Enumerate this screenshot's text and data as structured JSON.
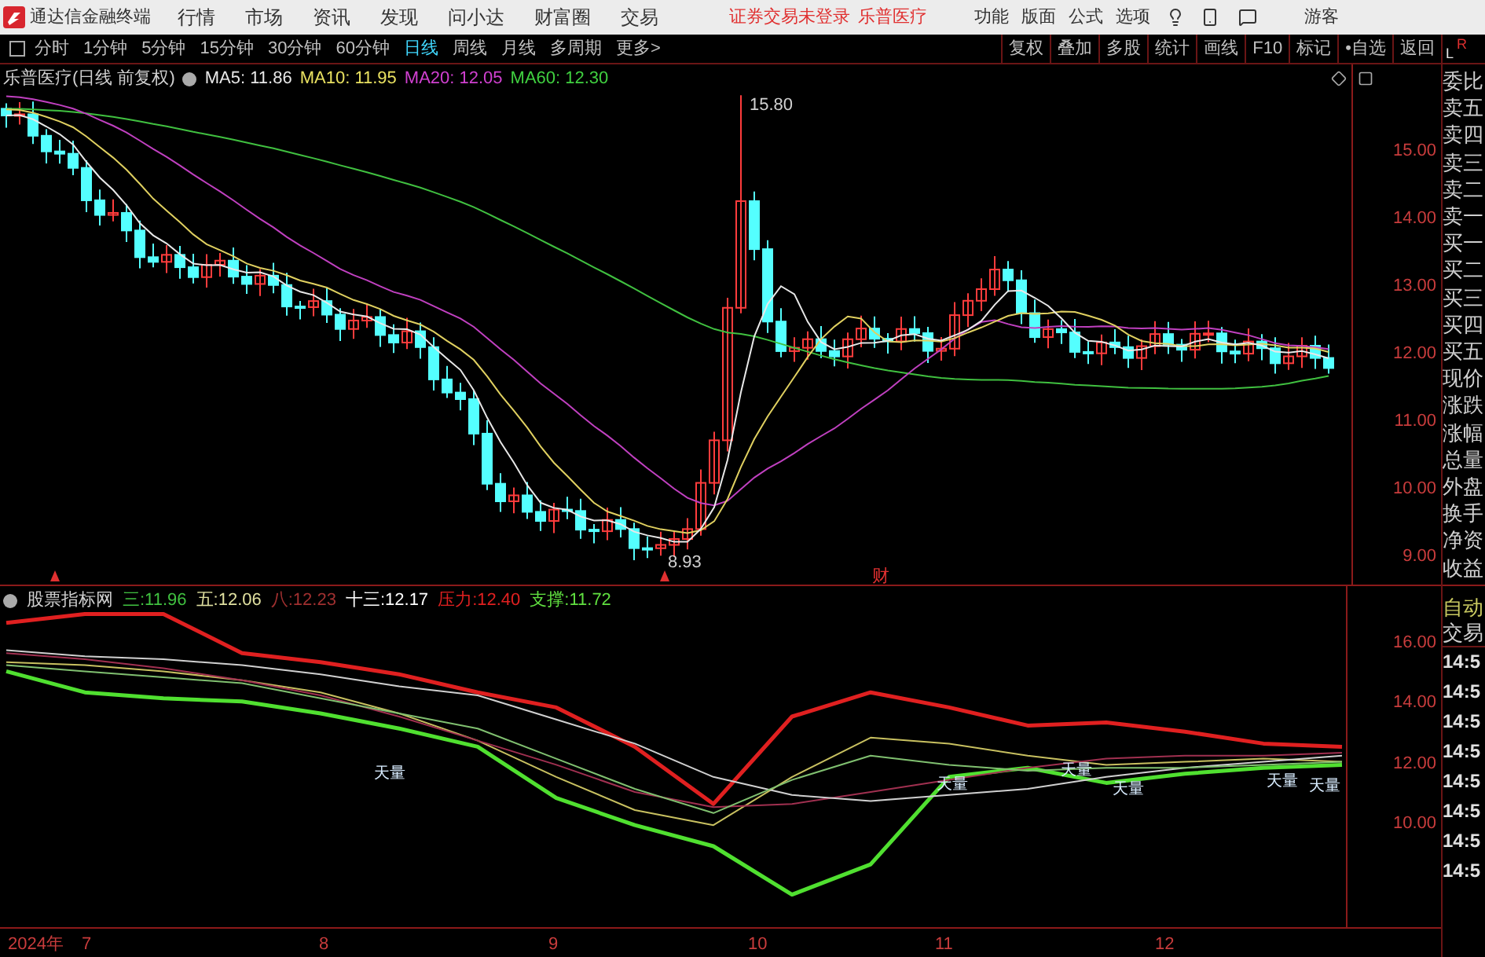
{
  "app": {
    "title": "通达信金融终端"
  },
  "menu": [
    "行情",
    "市场",
    "资讯",
    "发现",
    "问小达",
    "财富圈",
    "交易"
  ],
  "login_status": "证券交易未登录",
  "stock_name": "乐普医疗",
  "toolbar": [
    "功能",
    "版面",
    "公式",
    "选项"
  ],
  "user": "游客",
  "periods": [
    {
      "label": "分时",
      "selected": false
    },
    {
      "label": "1分钟",
      "selected": false
    },
    {
      "label": "5分钟",
      "selected": false
    },
    {
      "label": "15分钟",
      "selected": false
    },
    {
      "label": "30分钟",
      "selected": false
    },
    {
      "label": "60分钟",
      "selected": false
    },
    {
      "label": "日线",
      "selected": true
    },
    {
      "label": "周线",
      "selected": false
    },
    {
      "label": "月线",
      "selected": false
    },
    {
      "label": "多周期",
      "selected": false
    },
    {
      "label": "更多>",
      "selected": false
    }
  ],
  "chart_buttons": [
    "复权",
    "叠加",
    "多股",
    "统计",
    "画线",
    "F10",
    "标记",
    "•自选",
    "返回"
  ],
  "corner_labels": [
    "L",
    "R"
  ],
  "price_chart": {
    "title": "乐普医疗(日线 前复权)",
    "indicators": [
      {
        "label": "MA5: 11.86",
        "color": "#e8e8e8"
      },
      {
        "label": "MA10: 11.95",
        "color": "#e8e060"
      },
      {
        "label": "MA20: 12.05",
        "color": "#d040d0"
      },
      {
        "label": "MA60: 12.30",
        "color": "#40d040"
      }
    ],
    "axis": [
      "15.00",
      "14.00",
      "13.00",
      "12.00",
      "11.00",
      "10.00",
      "9.00"
    ],
    "high_label": "15.80",
    "low_label": "8.93",
    "event_marker": "财"
  },
  "indicator_panel": {
    "name": "股票指标网",
    "values": [
      {
        "label": "三:11.96",
        "color": "#40c040"
      },
      {
        "label": "五:12.06",
        "color": "#e0e0a0"
      },
      {
        "label": "八:12.23",
        "color": "#a03030"
      },
      {
        "label": "十三:12.17",
        "color": "#ffffff"
      },
      {
        "label": "压力:12.40",
        "color": "#e02020"
      },
      {
        "label": "支撑:11.72",
        "color": "#60e040"
      }
    ],
    "signals": [
      "天量",
      "天量",
      "天量",
      "天量",
      "天量",
      "天量"
    ],
    "chart_data": {
      "type": "line",
      "ylim": [
        6.52,
        17.82
      ],
      "yticks": [
        {
          "value": 16,
          "label": "16.00"
        },
        {
          "value": 14,
          "label": "14.00"
        },
        {
          "value": 12,
          "label": "12.00"
        },
        {
          "value": 10,
          "label": "10.00"
        }
      ],
      "series": [
        {
          "color": "#e02020",
          "values": [
            16.6,
            16.9,
            16.9,
            15.6,
            15.3,
            14.9,
            14.3,
            13.8,
            12.5,
            10.6,
            13.5,
            14.3,
            13.8,
            13.2,
            13.3,
            13.0,
            12.6,
            12.5
          ]
        },
        {
          "color": "#50e030",
          "values": [
            15.0,
            14.3,
            14.1,
            14.0,
            13.6,
            13.1,
            12.5,
            10.8,
            9.9,
            9.2,
            7.6,
            8.6,
            11.5,
            11.8,
            11.3,
            11.6,
            11.8,
            11.9
          ]
        },
        {
          "color": "#c8c060",
          "values": [
            15.3,
            15.2,
            15.0,
            14.7,
            14.3,
            13.6,
            12.7,
            11.5,
            10.4,
            9.9,
            11.5,
            12.8,
            12.6,
            12.2,
            11.9,
            12.0,
            12.1,
            12.0
          ]
        },
        {
          "color": "#a03050",
          "values": [
            15.6,
            15.4,
            15.1,
            14.7,
            14.2,
            13.5,
            12.7,
            11.9,
            11.0,
            10.5,
            10.6,
            11.0,
            11.4,
            11.8,
            12.1,
            12.2,
            12.2,
            12.3
          ]
        },
        {
          "color": "#d0d0d0",
          "values": [
            15.7,
            15.5,
            15.4,
            15.2,
            14.9,
            14.5,
            14.2,
            13.4,
            12.6,
            11.5,
            10.9,
            10.7,
            10.9,
            11.1,
            11.5,
            11.8,
            12.0,
            12.2
          ]
        },
        {
          "color": "#80c070",
          "values": [
            15.2,
            15.0,
            14.8,
            14.6,
            14.1,
            13.6,
            13.1,
            12.1,
            11.1,
            10.3,
            11.4,
            12.2,
            11.9,
            11.7,
            11.8,
            11.8,
            11.9,
            12.0
          ]
        }
      ]
    }
  },
  "quote_fields": [
    "委比",
    "卖五",
    "卖四",
    "卖三",
    "卖二",
    "卖一",
    "买一",
    "买二",
    "买三",
    "买四",
    "买五",
    "现价",
    "涨跌",
    "涨幅",
    "总量",
    "外盘",
    "换手",
    "净资",
    "收益"
  ],
  "trade_panel": {
    "title": [
      "自动",
      "交易"
    ],
    "times": [
      "14:5",
      "14:5",
      "14:5",
      "14:5",
      "14:5",
      "14:5",
      "14:5",
      "14:5"
    ]
  },
  "x_axis": [
    "2024年",
    "7",
    "8",
    "9",
    "10",
    "11",
    "12"
  ]
}
